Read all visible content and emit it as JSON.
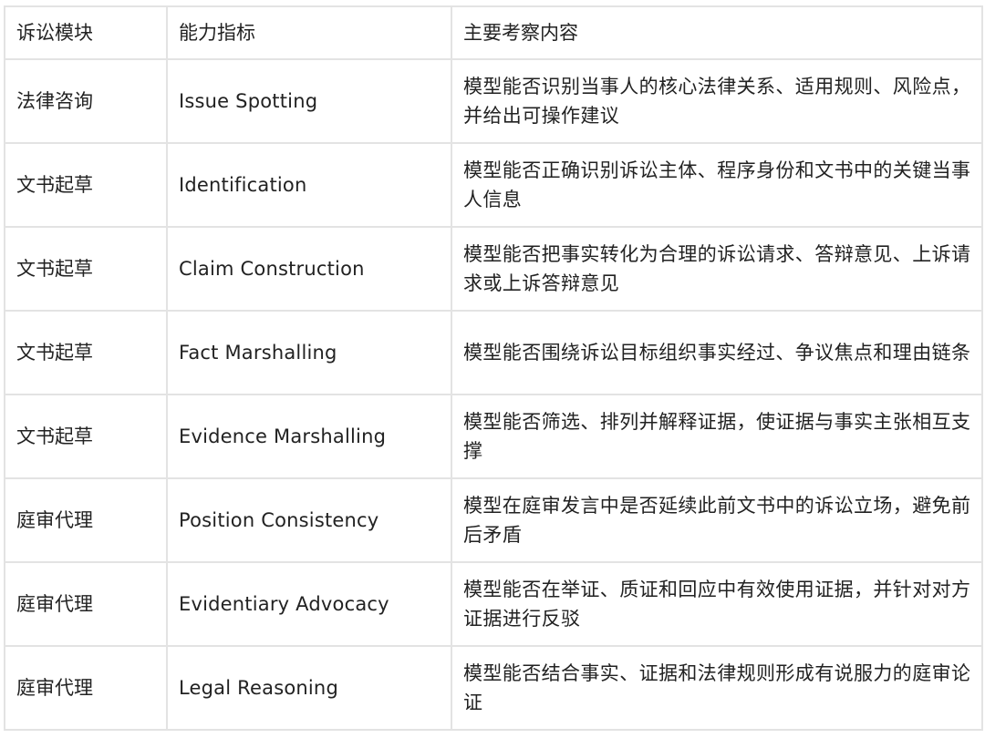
{
  "table": {
    "headers": [
      "诉讼模块",
      "能力指标",
      "主要考察内容"
    ],
    "rows": [
      [
        "法律咨询",
        "Issue Spotting",
        "模型能否识别当事人的核心法律关系、适用规则、风险点，并给出可操作建议"
      ],
      [
        "文书起草",
        "Identification",
        "模型能否正确识别诉讼主体、程序身份和文书中的关键当事人信息"
      ],
      [
        "文书起草",
        "Claim Construction",
        "模型能否把事实转化为合理的诉讼请求、答辩意见、上诉请求或上诉答辩意见"
      ],
      [
        "文书起草",
        "Fact Marshalling",
        "模型能否围绕诉讼目标组织事实经过、争议焦点和理由链条"
      ],
      [
        "文书起草",
        "Evidence Marshalling",
        "模型能否筛选、排列并解释证据，使证据与事实主张相互支撑"
      ],
      [
        "庭审代理",
        "Position Consistency",
        "模型在庭审发言中是否延续此前文书中的诉讼立场，避免前后矛盾"
      ],
      [
        "庭审代理",
        "Evidentiary Advocacy",
        "模型能否在举证、质证和回应中有效使用证据，并针对对方证据进行反驳"
      ],
      [
        "庭审代理",
        "Legal Reasoning",
        "模型能否结合事实、证据和法律规则形成有说服力的庭审论证"
      ]
    ]
  }
}
